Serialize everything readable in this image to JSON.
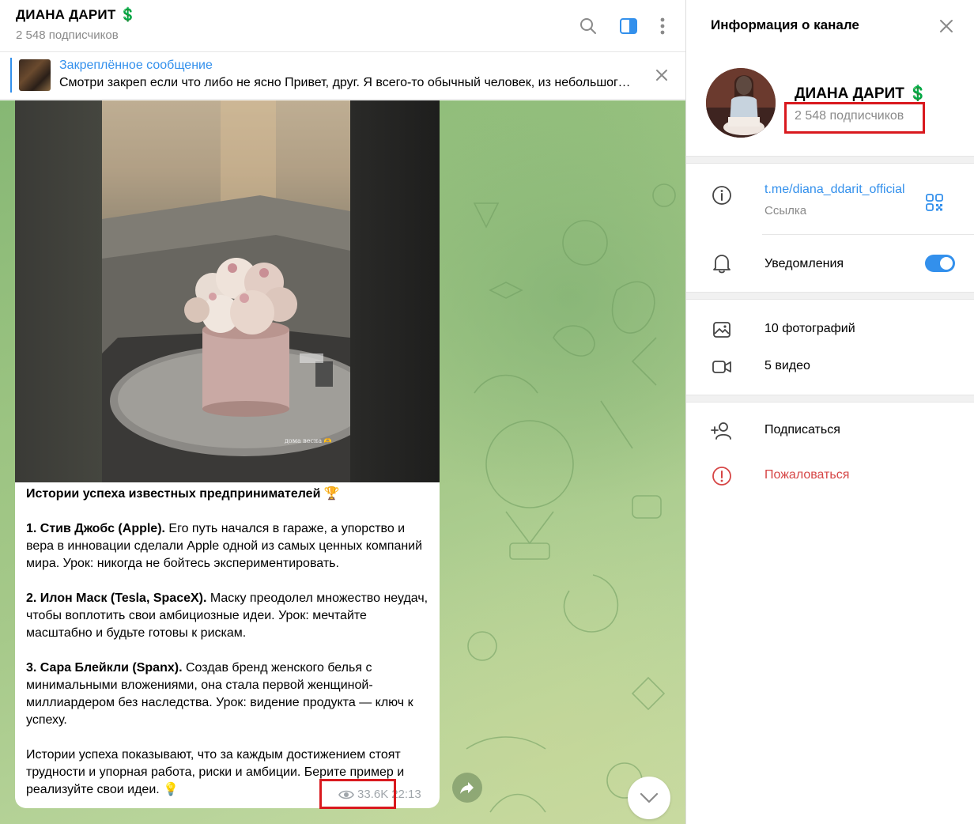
{
  "chat": {
    "title": "ДИАНА ДАРИТ 💲",
    "subscribers": "2 548 подписчиков",
    "header_icons": [
      "search-icon",
      "sidebar-toggle-icon",
      "more-vertical-icon"
    ],
    "pinned": {
      "title": "Закреплённое сообщение",
      "text": "Смотри закреп если что либо не ясно  Привет, друг. Я всего-то обычный человек, из небольшого города..."
    },
    "message": {
      "photo_caption": "дома весна 🫶",
      "title": "Истории успеха известных предпринимателей 🏆",
      "p1_bold": "1. Стив Джобс (Apple).",
      "p1_text": " Его путь начался в гараже, а упорство и вера в инновации сделали Apple одной из самых ценных компаний мира. Урок: никогда не бойтесь экспериментировать.",
      "p2_bold": "2. Илон Маск (Tesla, SpaceX).",
      "p2_text": " Маску преодолел множество неудач, чтобы воплотить свои амбициозные идеи. Урок: мечтайте масштабно и будьте готовы к рискам.",
      "p3_bold": "3. Сара Блейкли (Spanx).",
      "p3_text": " Создав бренд женского белья с минимальными вложениями, она стала первой женщиной-миллиардером без наследства. Урок: видение продукта — ключ к успеху.",
      "outro": "Истории успеха показывают, что за каждым достижением стоят трудности и упорная работа, риски и амбиции. Берите пример и реализуйте свои идеи. 💡",
      "views": "33.6K",
      "time": "22:13"
    }
  },
  "panel": {
    "title": "Информация о канале",
    "name": "ДИАНА ДАРИТ 💲",
    "subscribers": "2 548 подписчиков",
    "link": "t.me/diana_ddarit_official",
    "link_label": "Ссылка",
    "notifications_label": "Уведомления",
    "notifications_on": true,
    "photos": "10 фотографий",
    "videos": "5 видео",
    "subscribe": "Подписаться",
    "report": "Пожаловаться"
  },
  "colors": {
    "accent": "#3390ec",
    "danger": "#d64545",
    "highlight": "#d9191e"
  }
}
